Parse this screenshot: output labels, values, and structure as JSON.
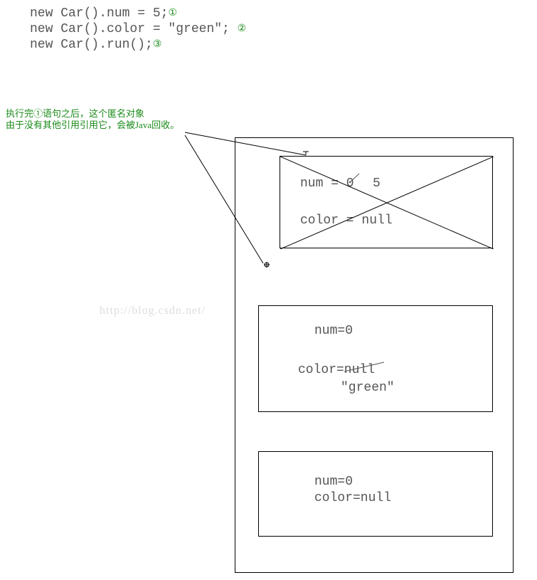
{
  "code": {
    "line1_a": "new Car().num = 5;",
    "line1_marker": "①",
    "line2_a": "new Car().color = \"green\";",
    "line2_marker": "②",
    "line3_a": "new Car().run();",
    "line3_marker": "③"
  },
  "annotation": {
    "line1": "执行完①语句之后，这个匿名对象",
    "line2": "由于没有其他引用引用它，会被Java回收。"
  },
  "watermark": "http://blog.csdn.net/",
  "obj1": {
    "num_label": "num = 0",
    "num_overwrite": "5",
    "color_label": "color = null"
  },
  "obj2": {
    "num_label": "num=0",
    "color_label": "color=null",
    "color_overwrite": "\"green\""
  },
  "obj3": {
    "num_label": "num=0",
    "color_label": "color=null"
  }
}
